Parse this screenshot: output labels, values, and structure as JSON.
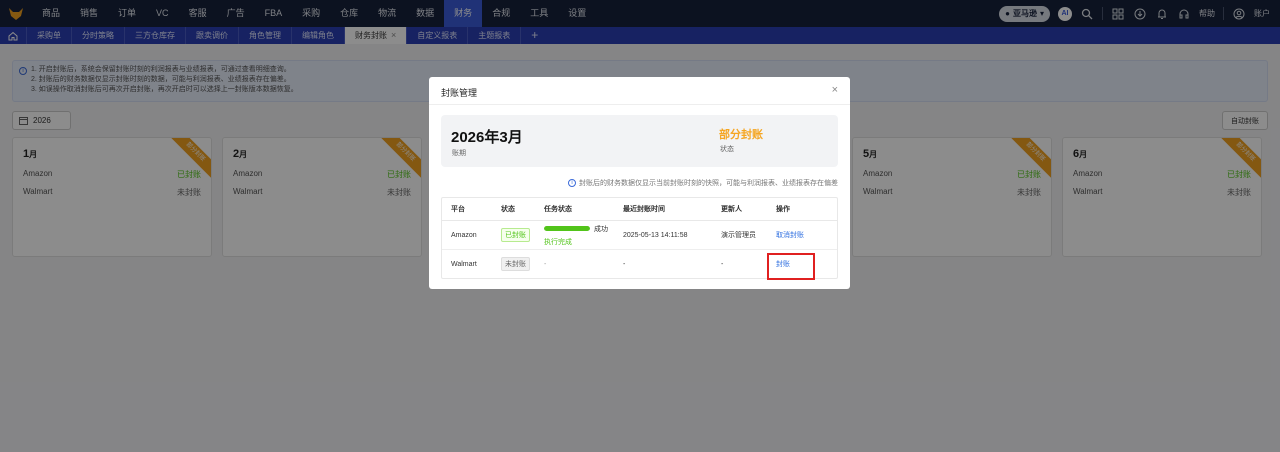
{
  "topbar": {
    "nav": [
      "商品",
      "销售",
      "订单",
      "VC",
      "客服",
      "广告",
      "FBA",
      "采购",
      "仓库",
      "物流",
      "数据",
      "财务",
      "合规",
      "工具",
      "设置"
    ],
    "active_nav": "财务",
    "store": "亚马逊",
    "ai": "AI",
    "help": "帮助",
    "account": "账户"
  },
  "tabs": [
    {
      "label": "采购单"
    },
    {
      "label": "分时策略"
    },
    {
      "label": "三方仓库存"
    },
    {
      "label": "跟卖调价"
    },
    {
      "label": "角色管理"
    },
    {
      "label": "编辑角色"
    },
    {
      "label": "财务封账",
      "active": true,
      "closable": true
    },
    {
      "label": "自定义报表"
    },
    {
      "label": "主题报表"
    }
  ],
  "add_tab": "+",
  "notice": [
    "1. 开启封账后，系统会保留封账时刻的利润报表与业绩报表，可通过查看明细查询。",
    "2. 封账后的财务数据仅显示封账时刻的数据，可能与利润报表、业绩报表存在偏差。",
    "3. 如误操作取消封账后可再次开启封账，再次开启时可以选择上一封账版本数据恢复。"
  ],
  "year": "2026",
  "auto_close_label": "自动封账",
  "ribbon_text": "部分封账",
  "month_suffix": "月",
  "months": [
    {
      "num": "1",
      "rows": [
        {
          "platform": "Amazon",
          "status": "已封账"
        },
        {
          "platform": "Walmart",
          "status": "未封账"
        }
      ]
    },
    {
      "num": "2",
      "rows": [
        {
          "platform": "Amazon",
          "status": "已封账"
        },
        {
          "platform": "Walmart",
          "status": "未封账"
        }
      ]
    },
    {
      "num": "5",
      "rows": [
        {
          "platform": "Amazon",
          "status": "已封账"
        },
        {
          "platform": "Walmart",
          "status": "未封账"
        }
      ]
    },
    {
      "num": "6",
      "rows": [
        {
          "platform": "Amazon",
          "status": "已封账"
        },
        {
          "platform": "Walmart",
          "status": "未封账"
        }
      ]
    }
  ],
  "modal": {
    "title": "封账管理",
    "close": "×",
    "period": "2026年3月",
    "period_label": "账期",
    "status": "部分封账",
    "status_label": "状态",
    "hint": "封账后的财务数据仅显示当前封账时刻的快照，可能与利润报表、业绩报表存在偏差",
    "headers": [
      "平台",
      "状态",
      "任务状态",
      "最近封账时间",
      "更新人",
      "操作"
    ],
    "rows": [
      {
        "platform": "Amazon",
        "status": "已封账",
        "progress": 1.0,
        "task_result": "成功",
        "task_status": "执行完成",
        "time": "2025-05-13 14:11:58",
        "updater": "演示管理员",
        "action": "取消封账"
      },
      {
        "platform": "Walmart",
        "status": "未封账",
        "task": "-",
        "time": "-",
        "updater": "-",
        "action": "封账"
      }
    ]
  },
  "colors": {
    "topbar": "#16213b",
    "tabbar": "#2b3fb3",
    "accent": "#3b5bd9",
    "success": "#52c41a",
    "warning": "#f5a623",
    "link": "#2f6fe0",
    "highlight": "#e02020"
  }
}
